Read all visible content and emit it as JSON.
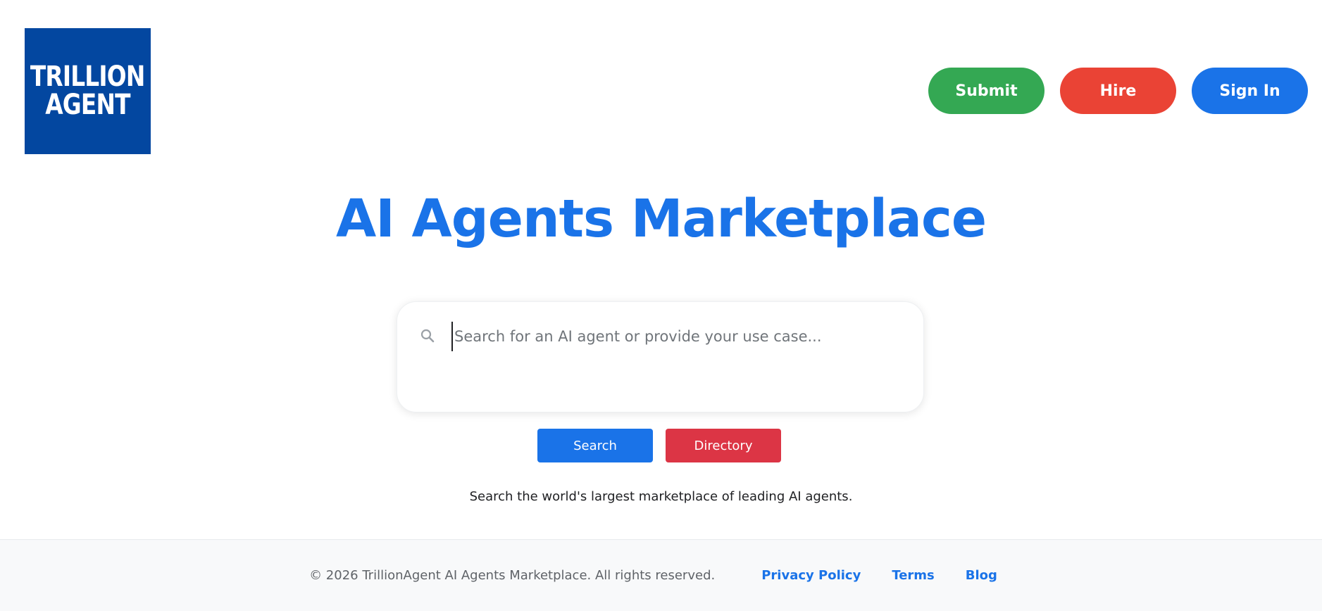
{
  "logo": {
    "line1": "TRILLION",
    "line2": "AGENT"
  },
  "nav": {
    "submit": "Submit",
    "hire": "Hire",
    "sign_in": "Sign In"
  },
  "hero": {
    "title": "AI Agents Marketplace"
  },
  "search": {
    "placeholder": "Search for an AI agent or provide your use case...",
    "value": "",
    "search_button": "Search",
    "directory_button": "Directory"
  },
  "tagline": "Search the world's largest marketplace of leading AI agents.",
  "footer": {
    "copyright": "© 2026 TrillionAgent AI Agents Marketplace. All rights reserved.",
    "links": [
      {
        "label": "Privacy Policy"
      },
      {
        "label": "Terms"
      },
      {
        "label": "Blog"
      }
    ]
  },
  "colors": {
    "brand_blue": "#1a73e8",
    "logo_bg": "#0347a0",
    "submit_green": "#34a853",
    "hire_red": "#ea4335",
    "directory_red": "#dc3545"
  },
  "icons": {
    "search": "search-icon"
  }
}
